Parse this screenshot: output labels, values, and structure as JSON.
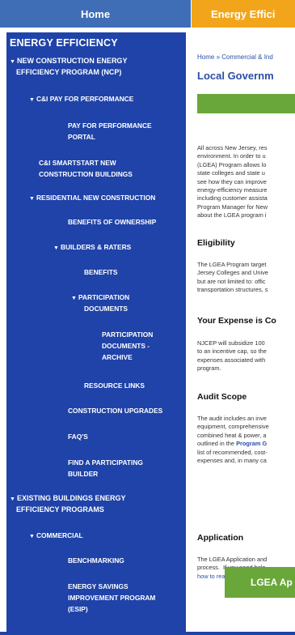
{
  "tabs": {
    "home": "Home",
    "energy": "Energy Effici"
  },
  "sidebar": {
    "title": "ENERGY EFFICIENCY",
    "items": [
      {
        "label": "NEW CONSTRUCTION ENERGY",
        "arrow": "▼"
      },
      {
        "label": "EFFICIENCY PROGRAM (NCP)"
      },
      {
        "label": "C&I PAY FOR PERFORMANCE",
        "arrow": "▼"
      },
      {
        "label": "PAY FOR PERFORMANCE"
      },
      {
        "label": "PORTAL"
      },
      {
        "label": "C&I SMARTSTART NEW"
      },
      {
        "label": "CONSTRUCTION BUILDINGS"
      },
      {
        "label": "RESIDENTIAL NEW CONSTRUCTION",
        "arrow": "▼"
      },
      {
        "label": "BENEFITS OF OWNERSHIP"
      },
      {
        "label": "BUILDERS & RATERS",
        "arrow": "▼"
      },
      {
        "label": "BENEFITS"
      },
      {
        "label": "PARTICIPATION",
        "arrow": "▼"
      },
      {
        "label": "DOCUMENTS"
      },
      {
        "label": "PARTICIPATION"
      },
      {
        "label": "DOCUMENTS -"
      },
      {
        "label": "ARCHIVE"
      },
      {
        "label": "RESOURCE LINKS"
      },
      {
        "label": "CONSTRUCTION UPGRADES"
      },
      {
        "label": "FAQ'S"
      },
      {
        "label": "FIND A PARTICIPATING"
      },
      {
        "label": "BUILDER"
      },
      {
        "label": "EXISTING BUILDINGS ENERGY",
        "arrow": "▼"
      },
      {
        "label": "EFFICIENCY PROGRAMS"
      },
      {
        "label": "COMMERCIAL",
        "arrow": "▼"
      },
      {
        "label": "BENCHMARKING"
      },
      {
        "label": "ENERGY SAVINGS"
      },
      {
        "label": "IMPROVEMENT PROGRAM"
      },
      {
        "label": "(ESIP)"
      }
    ]
  },
  "main": {
    "breadcrumb": "Home » Commercial & Ind",
    "title": "Local Governm",
    "intro": "All across New Jersey, res\nenvironment. In order to u\n(LGEA) Program allows lo\nstate colleges and state u\nsee how they can improve\nenergy-efficiency measure\nincluding customer assista\nProgram Manager for New\nabout the LGEA program i",
    "eligibility_heading": "Eligibility",
    "eligibility": "The LGEA Program target\nJersey Colleges and Unive\nbut are not limited to: offic\ntransportation structures, s",
    "expense_heading": "Your Expense is Co",
    "expense": "NJCEP will subsidize 100\nto an incentive cap, so the\nexpenses associated with\nprogram.",
    "audit_heading": "Audit Scope",
    "audit_lines": [
      "The audit includes an inve",
      "equipment, comprehensive",
      "combined heat & power, a",
      "outlined in the ",
      "list of recommended, cost-",
      "expenses and, in many ca"
    ],
    "audit_link": "Program G",
    "application_heading": "Application",
    "application_lines": [
      "The LGEA Application and",
      "process.  If you need help"
    ],
    "application_link": "how to read and understa",
    "cta": "LGEA Ap"
  }
}
